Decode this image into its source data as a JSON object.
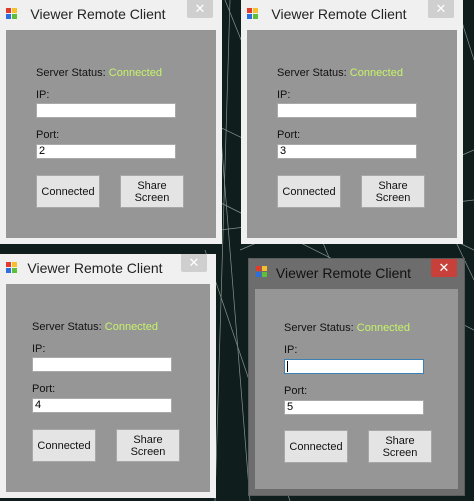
{
  "windows": [
    {
      "title": "Viewer Remote Client",
      "close_glyph": "✕",
      "status_label": "Server Status:",
      "status_value": "Connected",
      "ip_label": "IP:",
      "ip_value": "",
      "port_label": "Port:",
      "port_value": "2",
      "connect_label": "Connected",
      "share_label_line1": "Share",
      "share_label_line2": "Screen",
      "active": false
    },
    {
      "title": "Viewer Remote Client",
      "close_glyph": "✕",
      "status_label": "Server Status:",
      "status_value": "Connected",
      "ip_label": "IP:",
      "ip_value": "",
      "port_label": "Port:",
      "port_value": "3",
      "connect_label": "Connected",
      "share_label_line1": "Share",
      "share_label_line2": "Screen",
      "active": false
    },
    {
      "title": "Viewer Remote Client",
      "close_glyph": "✕",
      "status_label": "Server Status:",
      "status_value": "Connected",
      "ip_label": "IP:",
      "ip_value": "",
      "port_label": "Port:",
      "port_value": "4",
      "connect_label": "Connected",
      "share_label_line1": "Share",
      "share_label_line2": "Screen",
      "active": false
    },
    {
      "title": "Viewer Remote Client",
      "close_glyph": "✕",
      "status_label": "Server Status:",
      "status_value": "Connected",
      "ip_label": "IP:",
      "ip_value": "",
      "port_label": "Port:",
      "port_value": "5",
      "connect_label": "Connected",
      "share_label_line1": "Share",
      "share_label_line2": "Screen",
      "active": true
    }
  ],
  "colors": {
    "desktop": "#0f1d1c",
    "client_area": "#969696",
    "status_connected": "#c7f36a",
    "active_close": "#c7403a",
    "focus_border": "#3c7fb1"
  },
  "icons": {
    "app": "colored-windows-icon",
    "close": "close-icon"
  }
}
